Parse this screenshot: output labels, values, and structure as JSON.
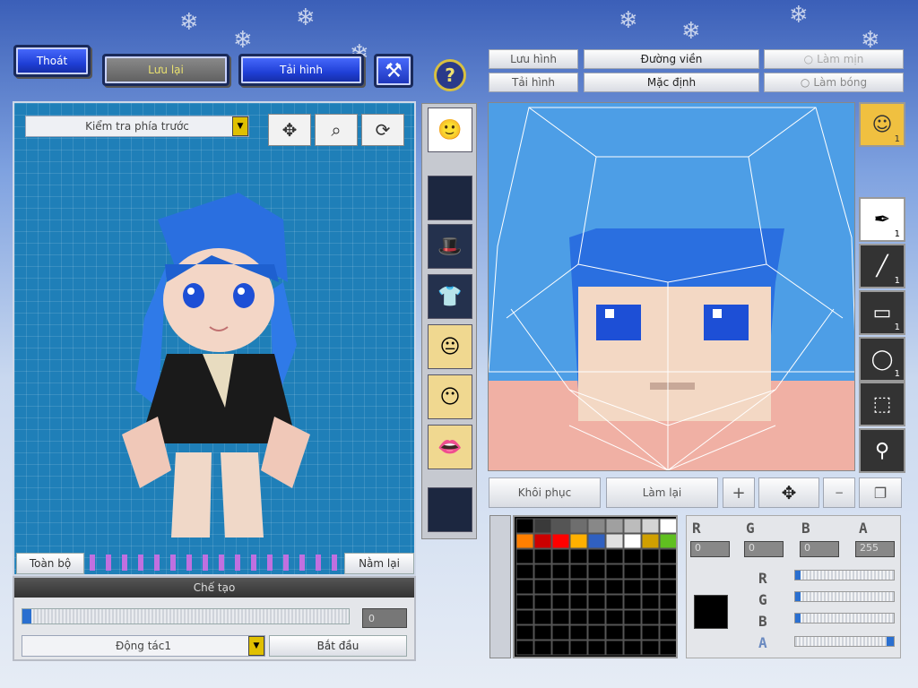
{
  "top_buttons": {
    "exit": "Thoát",
    "save": "Lưu lại",
    "reload": "Tải hình"
  },
  "preview": {
    "view_select": "Kiểm tra phía trước",
    "all_button": "Toàn bộ",
    "lie_down_button": "Nằm lại"
  },
  "bottom": {
    "header": "Chế tạo",
    "slider_value": "0",
    "action_select": "Động tác1",
    "start_button": "Bắt đầu"
  },
  "editor": {
    "save_image": "Lưu hình",
    "reload_image": "Tải hình",
    "outline": "Đường viền",
    "default": "Mặc định",
    "smooth": "Làm mịn",
    "shadow": "Làm bóng",
    "restore": "Khôi phục",
    "redo": "Làm lại"
  },
  "tools": [
    {
      "icon": "face-icon",
      "count": "1"
    },
    {
      "icon": "pen-icon",
      "count": "1"
    },
    {
      "icon": "line-icon",
      "count": "1"
    },
    {
      "icon": "rect-icon",
      "count": "1"
    },
    {
      "icon": "ellipse-icon",
      "count": "1"
    },
    {
      "icon": "select-icon",
      "count": ""
    },
    {
      "icon": "eyedropper-icon",
      "count": ""
    }
  ],
  "color": {
    "r": "0",
    "g": "0",
    "b": "0",
    "a": "255",
    "current": "#000000"
  },
  "palette_colors": [
    "#000000",
    "#3a3a3a",
    "#555555",
    "#6e6e6e",
    "#888888",
    "#a0a0a0",
    "#bcbcbc",
    "#d4d4d4",
    "#ffffff",
    "#ff7f00",
    "#cc0000",
    "#ff0000",
    "#ffb000",
    "#3060c0",
    "#e0e0e0",
    "#ffffff",
    "#d0a000",
    "#60c020"
  ]
}
